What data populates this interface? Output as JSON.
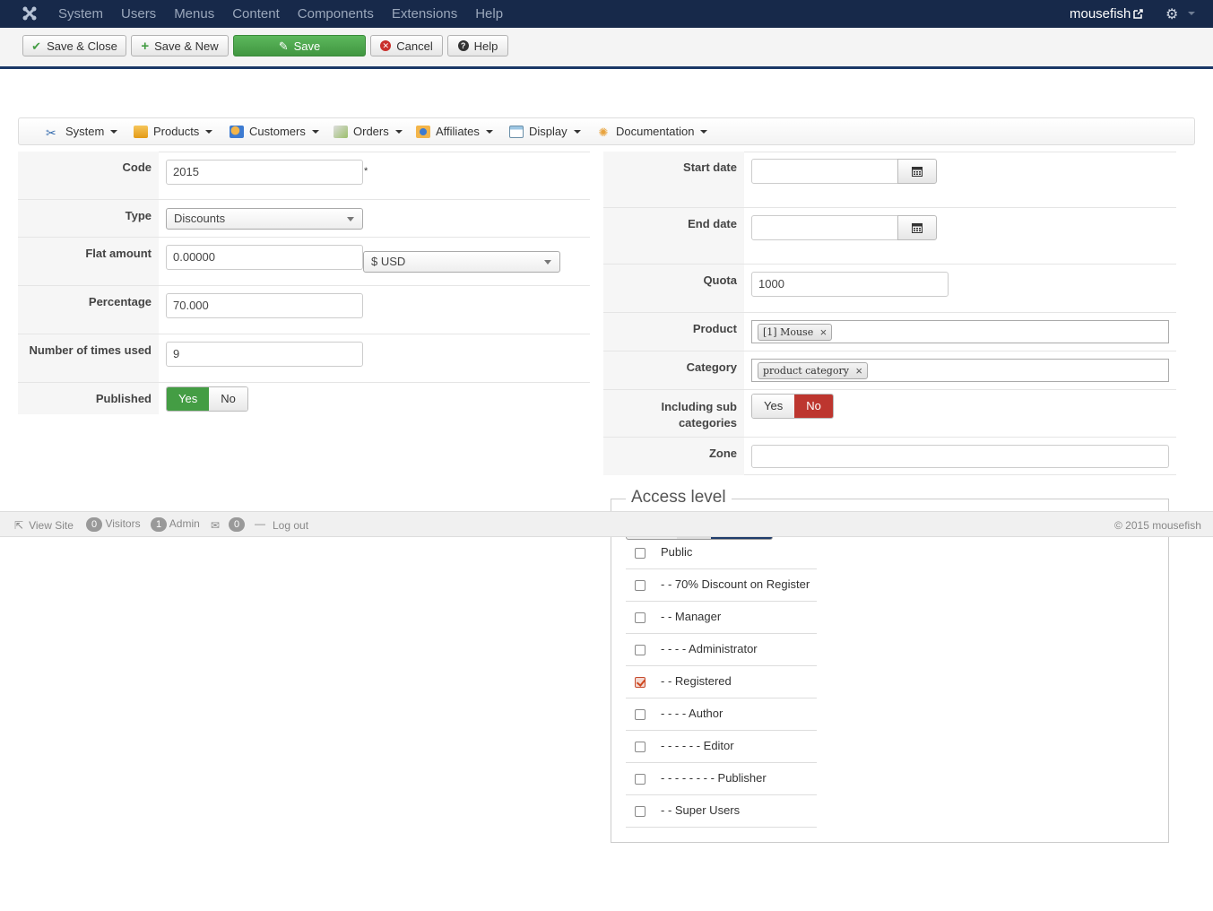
{
  "topnav": {
    "menu": [
      "System",
      "Users",
      "Menus",
      "Content",
      "Components",
      "Extensions",
      "Help"
    ],
    "user": "mousefish"
  },
  "toolbar": {
    "save_close": "Save & Close",
    "save_new": "Save & New",
    "save": "Save",
    "cancel": "Cancel",
    "help": "Help"
  },
  "subnav": [
    "System",
    "Products",
    "Customers",
    "Orders",
    "Affiliates",
    "Display",
    "Documentation"
  ],
  "left_form": {
    "code_label": "Code",
    "code_value": "2015",
    "required_mark": "*",
    "type_label": "Type",
    "type_value": "Discounts",
    "flat_label": "Flat amount",
    "flat_value": "0.00000",
    "currency_value": "$ USD",
    "percentage_label": "Percentage",
    "percentage_value": "70.000",
    "times_label": "Number of times used",
    "times_value": "9",
    "published_label": "Published",
    "yes": "Yes",
    "no": "No"
  },
  "right_form": {
    "start_label": "Start date",
    "start_value": "",
    "end_label": "End date",
    "end_value": "",
    "quota_label": "Quota",
    "quota_value": "1000",
    "product_label": "Product",
    "product_tag": "[1] Mouse",
    "category_label": "Category",
    "category_tag": "product category",
    "subcat_label_1": "Including sub",
    "subcat_label_2": "categories",
    "yes": "Yes",
    "no": "No",
    "zone_label": "Zone",
    "zone_value": ""
  },
  "access": {
    "legend": "Access level",
    "items": [
      {
        "label": "Public",
        "checked": false
      },
      {
        "label": "- - 70% Discount on Register",
        "checked": false
      },
      {
        "label": "- - Manager",
        "checked": false
      },
      {
        "label": "- - - - Administrator",
        "checked": false
      },
      {
        "label": "- - Registered",
        "checked": true
      },
      {
        "label": "- - - - Author",
        "checked": false
      },
      {
        "label": "- - - - - - Editor",
        "checked": false
      },
      {
        "label": "- - - - - - - - Publisher",
        "checked": false
      },
      {
        "label": "- - Super Users",
        "checked": false
      }
    ]
  },
  "footer": {
    "view_site": "View Site",
    "visitors_count": "0",
    "visitors": "Visitors",
    "admin_count": "1",
    "admin": "Admin",
    "messages_count": "0",
    "logout": "Log out",
    "copyright": "© 2015 mousefish"
  }
}
